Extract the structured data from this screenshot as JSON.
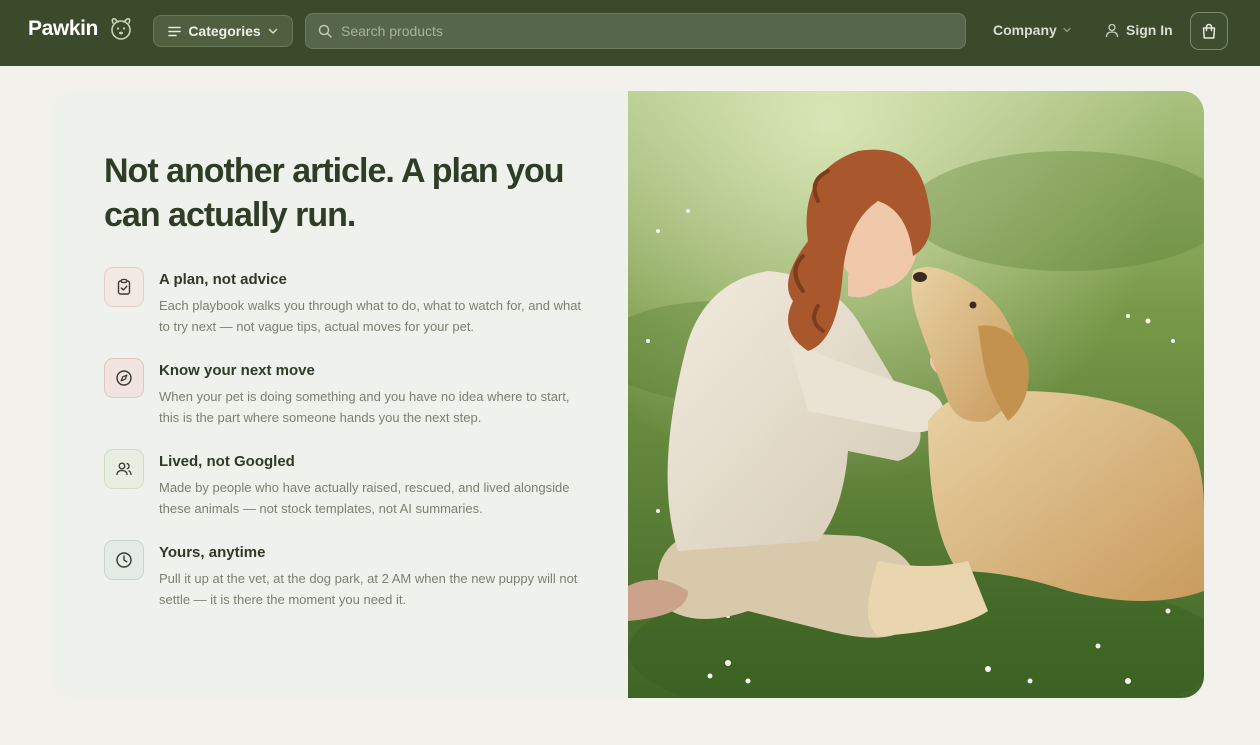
{
  "header": {
    "brand": "Pawkin",
    "categories_label": "Categories",
    "search_placeholder": "Search products",
    "company_label": "Company",
    "signin_label": "Sign In"
  },
  "hero": {
    "headline": "Not another article. A plan you can actually run.",
    "features": [
      {
        "icon": "clipboard-check-icon",
        "title": "A plan, not advice",
        "description": "Each playbook walks you through what to do, what to watch for, and what to try next — not vague tips, actual moves for your pet."
      },
      {
        "icon": "compass-icon",
        "title": "Know your next move",
        "description": "When your pet is doing something and you have no idea where to start, this is the part where someone hands you the next step."
      },
      {
        "icon": "users-icon",
        "title": "Lived, not Googled",
        "description": "Made by people who have actually raised, rescued, and lived alongside these animals — not stock templates, not AI summaries."
      },
      {
        "icon": "clock-icon",
        "title": "Yours, anytime",
        "description": "Pull it up at the vet, at the dog park, at 2 AM when the new puppy will not settle — it is there the moment you need it."
      }
    ]
  },
  "colors": {
    "header_bg": "#3a4a2b",
    "page_bg": "#f2f1ec",
    "card_bg": "#eef1ec",
    "headline": "#2f3d26"
  }
}
